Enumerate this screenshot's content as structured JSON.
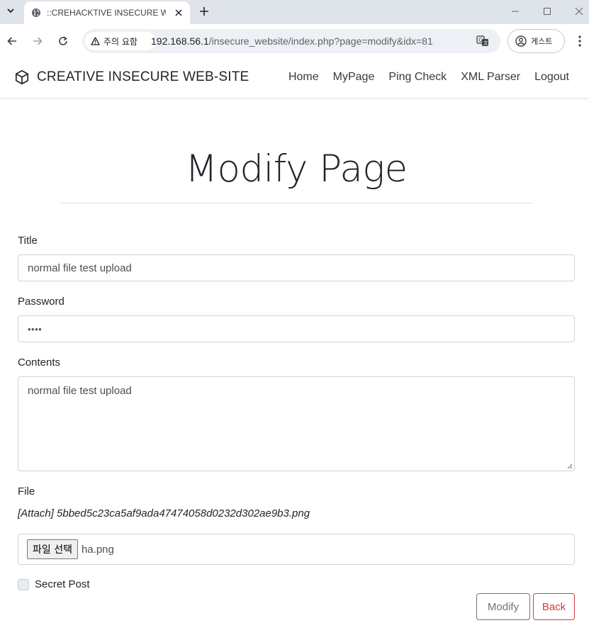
{
  "browser": {
    "tab_title": "::CREHACKTIVE INSECURE WEB",
    "security_chip": "주의 요함",
    "url_host": "192.168.56.1",
    "url_path": "/insecure_website/index.php?page=modify&idx=81",
    "profile_label": "게스트"
  },
  "navbar": {
    "brand": "CREATIVE INSECURE WEB-SITE",
    "links": [
      "Home",
      "MyPage",
      "Ping Check",
      "XML Parser",
      "Logout"
    ]
  },
  "page": {
    "title": "Modify Page"
  },
  "form": {
    "title_label": "Title",
    "title_value": "normal file test upload",
    "password_label": "Password",
    "password_mask": "••••",
    "contents_label": "Contents",
    "contents_value": "normal file test upload",
    "file_label": "File",
    "attach_text": "[Attach] 5bbed5c23ca5af9ada47474058d0232d302ae9b3.png",
    "file_button": "파일 선택",
    "file_name": "ha.png",
    "secret_label": "Secret Post",
    "secret_checked": false,
    "modify_button": "Modify",
    "back_button": "Back"
  },
  "colors": {
    "modify_border": "#6c757d",
    "back_accent": "#dc3545",
    "tabstrip_bg": "#dfe3ea"
  }
}
